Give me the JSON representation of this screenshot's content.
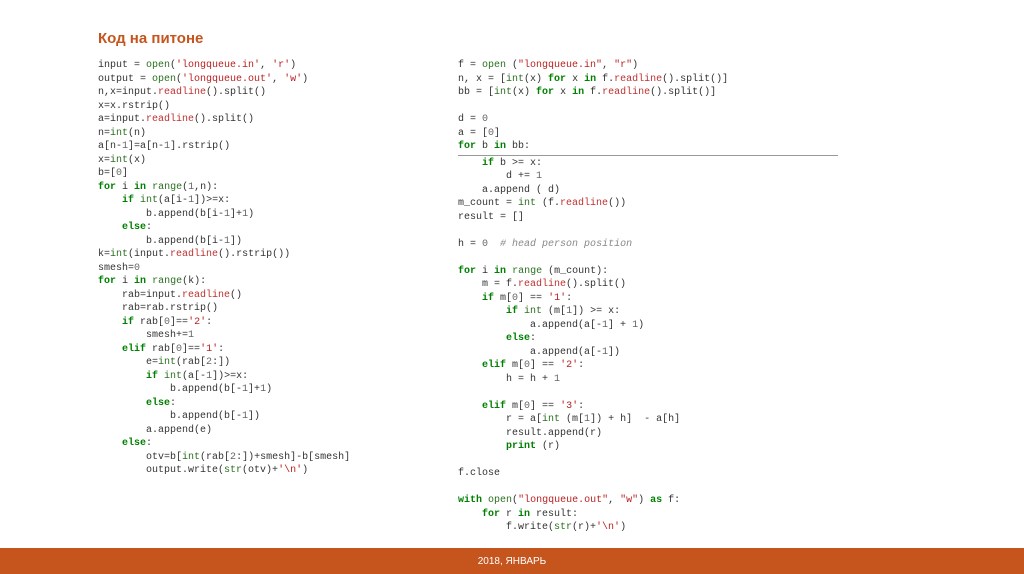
{
  "title": "Код на питоне",
  "footer": "2018, ЯНВАРЬ",
  "left": {
    "l01a": "input = ",
    "l01b": "open",
    "l01c": "(",
    "l01d": "'longqueue.in'",
    "l01e": ", ",
    "l01f": "'r'",
    "l01g": ")",
    "l02a": "output = ",
    "l02b": "open",
    "l02c": "(",
    "l02d": "'longqueue.out'",
    "l02e": ", ",
    "l02f": "'w'",
    "l02g": ")",
    "l03a": "n,x=input.",
    "l03b": "readline",
    "l03c": "().split()",
    "l04": "x=x.rstrip()",
    "l05a": "a=input.",
    "l05b": "readline",
    "l05c": "().split()",
    "l06a": "n=",
    "l06b": "int",
    "l06c": "(n)",
    "l07a": "a[n-",
    "l07b": "1",
    "l07c": "]=a[n-",
    "l07d": "1",
    "l07e": "].rstrip()",
    "l08a": "x=",
    "l08b": "int",
    "l08c": "(x)",
    "l09a": "b=[",
    "l09b": "0",
    "l09c": "]",
    "l10a": "for",
    "l10b": " i ",
    "l10c": "in",
    "l10d": " ",
    "l10e": "range",
    "l10f": "(",
    "l10g": "1",
    "l10h": ",n):",
    "l11a": "    if",
    "l11b": " ",
    "l11c": "int",
    "l11d": "(a[i-",
    "l11e": "1",
    "l11f": "])>=x:",
    "l12a": "        b.append(b[i-",
    "l12b": "1",
    "l12c": "]+",
    "l12d": "1",
    "l12e": ")",
    "l13a": "    else",
    "l13b": ":",
    "l14a": "        b.append(b[i-",
    "l14b": "1",
    "l14c": "])",
    "l15a": "k=",
    "l15b": "int",
    "l15c": "(input.",
    "l15d": "readline",
    "l15e": "().rstrip())",
    "l16a": "smesh=",
    "l16b": "0",
    "l17a": "for",
    "l17b": " i ",
    "l17c": "in",
    "l17d": " ",
    "l17e": "range",
    "l17f": "(k):",
    "l18a": "    rab=input.",
    "l18b": "readline",
    "l18c": "()",
    "l19": "    rab=rab.rstrip()",
    "l20a": "    if",
    "l20b": " rab[",
    "l20c": "0",
    "l20d": "]==",
    "l20e": "'2'",
    "l20f": ":",
    "l21a": "        smesh+=",
    "l21b": "1",
    "l22a": "    elif",
    "l22b": " rab[",
    "l22c": "0",
    "l22d": "]==",
    "l22e": "'1'",
    "l22f": ":",
    "l23a": "        e=",
    "l23b": "int",
    "l23c": "(rab[",
    "l23d": "2",
    "l23e": ":])",
    "l24a": "        if",
    "l24b": " ",
    "l24c": "int",
    "l24d": "(a[-",
    "l24e": "1",
    "l24f": "])>=x:",
    "l25a": "            b.append(b[-",
    "l25b": "1",
    "l25c": "]+",
    "l25d": "1",
    "l25e": ")",
    "l26a": "        else",
    "l26b": ":",
    "l27a": "            b.append(b[-",
    "l27b": "1",
    "l27c": "])",
    "l28": "        a.append(e)",
    "l29a": "    else",
    "l29b": ":",
    "l30a": "        otv=b[",
    "l30b": "int",
    "l30c": "(rab[",
    "l30d": "2",
    "l30e": ":])+smesh]-b[smesh]",
    "l31a": "        output.write(",
    "l31b": "str",
    "l31c": "(otv)+",
    "l31d": "'\\n'",
    "l31e": ")"
  },
  "right": {
    "r01a": "f = ",
    "r01b": "open",
    "r01c": " (",
    "r01d": "\"longqueue.in\"",
    "r01e": ", ",
    "r01f": "\"r\"",
    "r01g": ")",
    "r02a": "n, x = [",
    "r02b": "int",
    "r02c": "(x) ",
    "r02d": "for",
    "r02e": " x ",
    "r02f": "in",
    "r02g": " f.",
    "r02h": "readline",
    "r02i": "().split()]",
    "r03a": "bb = [",
    "r03b": "int",
    "r03c": "(x) ",
    "r03d": "for",
    "r03e": " x ",
    "r03f": "in",
    "r03g": " f.",
    "r03h": "readline",
    "r03i": "().split()]",
    "r04": " ",
    "r05a": "d = ",
    "r05b": "0",
    "r06a": "a = [",
    "r06b": "0",
    "r06c": "]",
    "r07a": "for",
    "r07b": " b ",
    "r07c": "in",
    "r07d": " bb:",
    "r08a": "    if",
    "r08b": " b >= x:",
    "r09a": "        d += ",
    "r09b": "1",
    "r10": "    a.append ( d)",
    "r11a": "m_count = ",
    "r11b": "int",
    "r11c": " (f.",
    "r11d": "readline",
    "r11e": "())",
    "r12": "result = []",
    "r13": " ",
    "r14a": "h = ",
    "r14b": "0",
    "r14c": "  ",
    "r14d": "# head person position",
    "r15": " ",
    "r16a": "for",
    "r16b": " i ",
    "r16c": "in",
    "r16d": " ",
    "r16e": "range",
    "r16f": " (m_count):",
    "r17a": "    m = f.",
    "r17b": "readline",
    "r17c": "().split()",
    "r18a": "    if",
    "r18b": " m[",
    "r18c": "0",
    "r18d": "] == ",
    "r18e": "'1'",
    "r18f": ":",
    "r19a": "        if",
    "r19b": " ",
    "r19c": "int",
    "r19d": " (m[",
    "r19e": "1",
    "r19f": "]) >= x:",
    "r20a": "            a.append(a[-",
    "r20b": "1",
    "r20c": "] + ",
    "r20d": "1",
    "r20e": ")",
    "r21a": "        else",
    "r21b": ":",
    "r22a": "            a.append(a[-",
    "r22b": "1",
    "r22c": "])",
    "r23a": "    elif",
    "r23b": " m[",
    "r23c": "0",
    "r23d": "] == ",
    "r23e": "'2'",
    "r23f": ":",
    "r24a": "        h = h + ",
    "r24b": "1",
    "r25": " ",
    "r26a": "    elif",
    "r26b": " m[",
    "r26c": "0",
    "r26d": "] == ",
    "r26e": "'3'",
    "r26f": ":",
    "r27a": "        r = a[",
    "r27b": "int",
    "r27c": " (m[",
    "r27d": "1",
    "r27e": "]) + h]  - a[h]",
    "r28": "        result.append(r)",
    "r29a": "        ",
    "r29b": "print",
    "r29c": " (r)",
    "r30": " ",
    "r31": "f.close",
    "r32": " ",
    "r33a": "with",
    "r33b": " ",
    "r33c": "open",
    "r33d": "(",
    "r33e": "\"longqueue.out\"",
    "r33f": ", ",
    "r33g": "\"w\"",
    "r33h": ") ",
    "r33i": "as",
    "r33j": " f:",
    "r34a": "    for",
    "r34b": " r ",
    "r34c": "in",
    "r34d": " result:",
    "r35a": "        f.write(",
    "r35b": "str",
    "r35c": "(r)+",
    "r35d": "'\\n'",
    "r35e": ")"
  }
}
